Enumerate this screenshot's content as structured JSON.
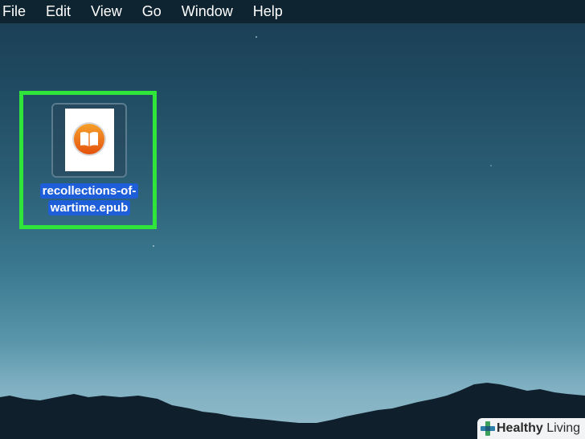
{
  "menubar": {
    "items": [
      "File",
      "Edit",
      "View",
      "Go",
      "Window",
      "Help"
    ]
  },
  "desktop": {
    "file": {
      "name_line1": "recollections-of-",
      "name_line2": "wartime.epub",
      "icon": "ibooks-icon",
      "selected": true
    },
    "highlight_color": "#2fe53a"
  },
  "watermark": {
    "brand_bold": "Healthy",
    "brand_rest": " Living",
    "icon": "plus-cross-icon"
  }
}
